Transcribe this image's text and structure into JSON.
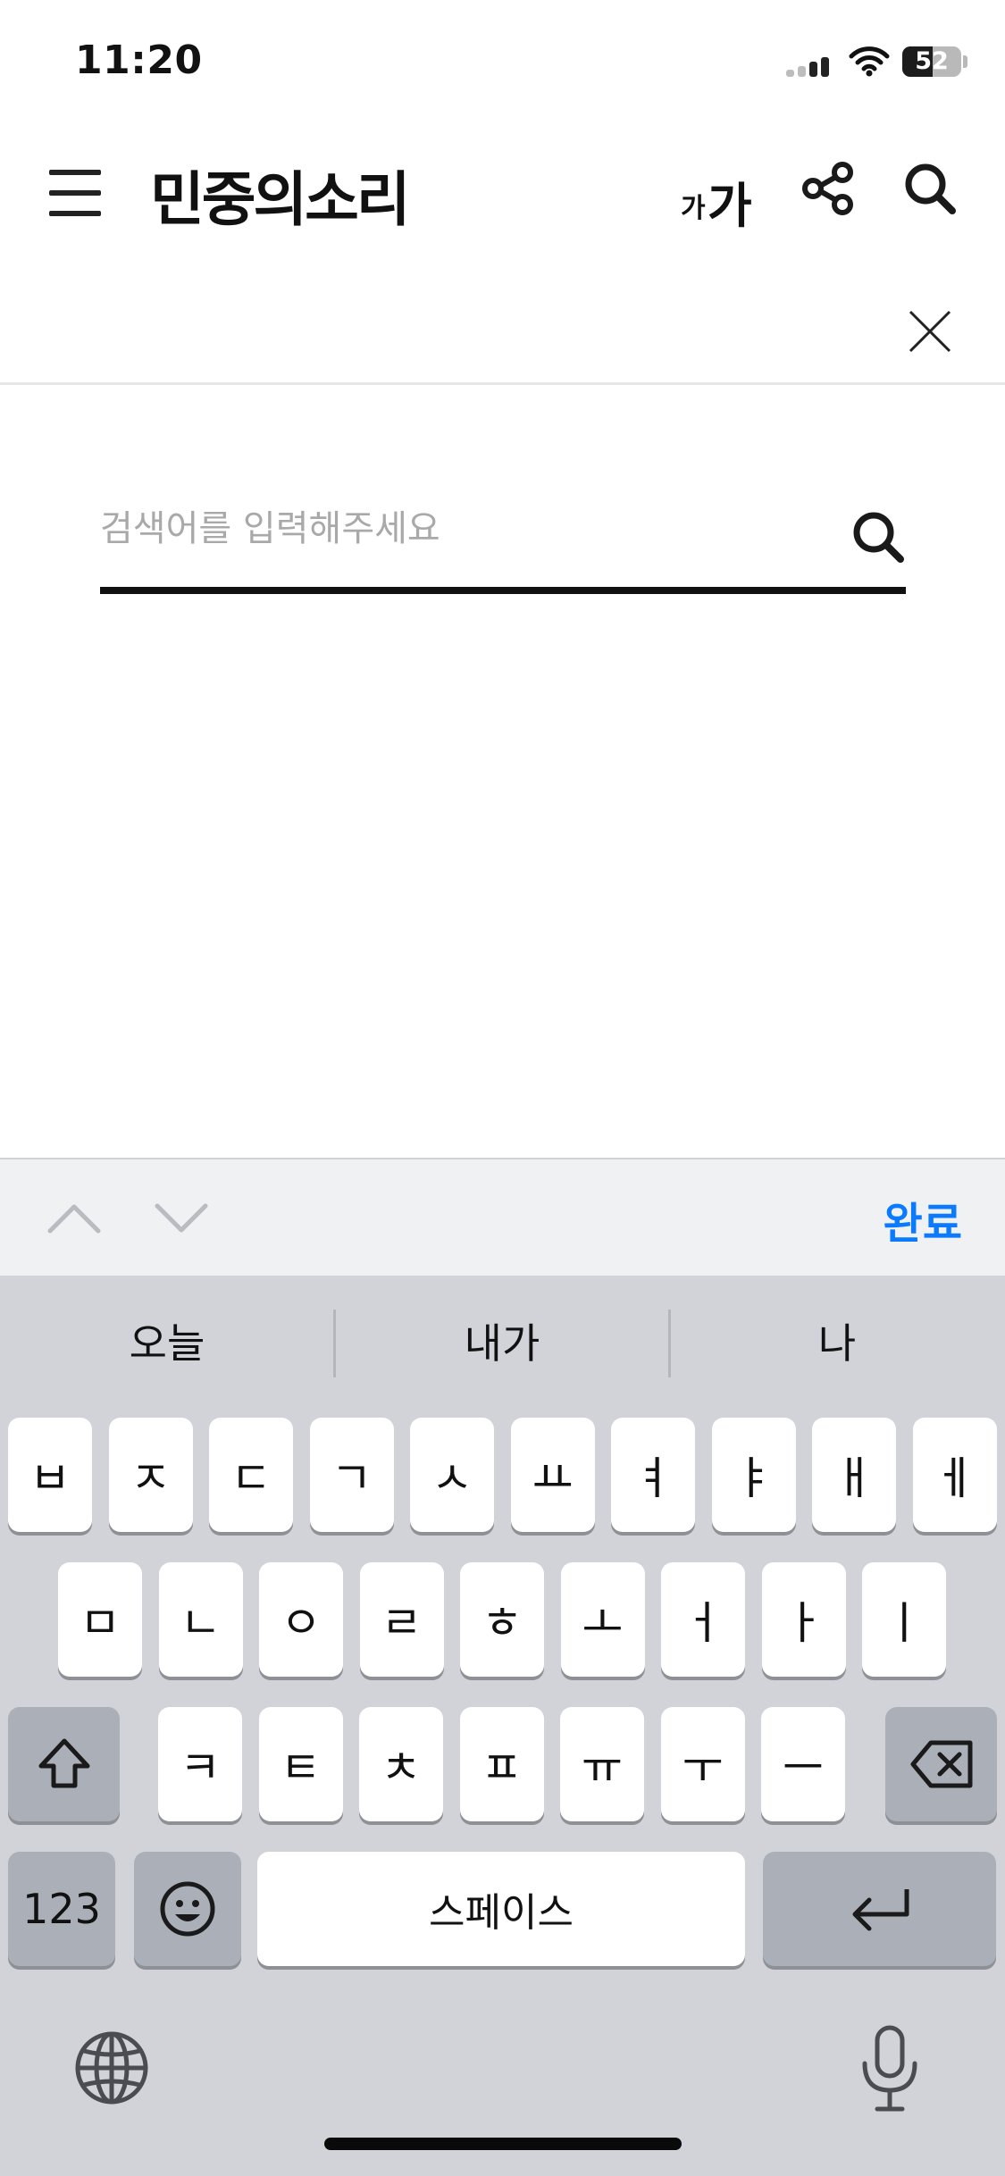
{
  "status": {
    "time": "11:20",
    "battery": "52",
    "battery_level_percent": 52
  },
  "header": {
    "logo": "민중의소리",
    "font_small": "가",
    "font_large": "가"
  },
  "search": {
    "placeholder": "검색어를 입력해주세요",
    "value": ""
  },
  "accessory": {
    "done_label": "완료"
  },
  "keyboard": {
    "predictions": [
      "오늘",
      "내가",
      "나"
    ],
    "row1": [
      "ㅂ",
      "ㅈ",
      "ㄷ",
      "ㄱ",
      "ㅅ",
      "ㅛ",
      "ㅕ",
      "ㅑ",
      "ㅐ",
      "ㅔ"
    ],
    "row2": [
      "ㅁ",
      "ㄴ",
      "ㅇ",
      "ㄹ",
      "ㅎ",
      "ㅗ",
      "ㅓ",
      "ㅏ",
      "ㅣ"
    ],
    "row3": [
      "ㅋ",
      "ㅌ",
      "ㅊ",
      "ㅍ",
      "ㅠ",
      "ㅜ",
      "ㅡ"
    ],
    "numbers_label": "123",
    "space_label": "스페이스"
  },
  "icons": {
    "menu": "hamburger-menu-icon",
    "share": "share-icon",
    "search": "search-icon",
    "close": "close-icon",
    "shift": "shift-icon",
    "backspace": "backspace-icon",
    "emoji": "emoji-icon",
    "return": "return-icon",
    "globe": "globe-icon",
    "mic": "microphone-icon"
  }
}
